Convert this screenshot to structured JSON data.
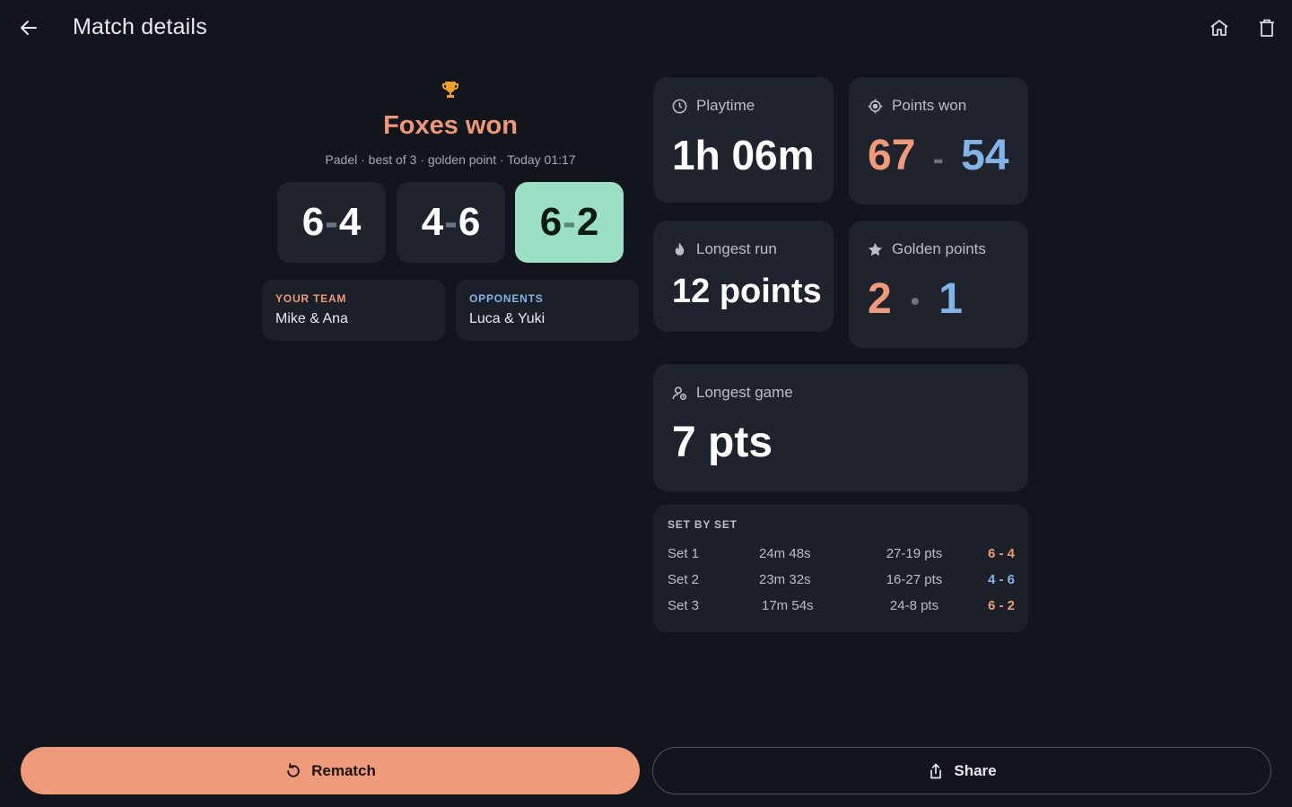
{
  "header": {
    "title": "Match details",
    "back_icon": "arrow-left-icon",
    "home_icon": "home-icon",
    "delete_icon": "trash-icon"
  },
  "summary": {
    "icon": "trophy-icon",
    "winner_text": "Foxes won",
    "meta": "Padel · best of 3 · golden point · Today 01:17"
  },
  "sets": [
    {
      "a": "6",
      "b": "4",
      "winner": false
    },
    {
      "a": "4",
      "b": "6",
      "winner": false
    },
    {
      "a": "6",
      "b": "2",
      "winner": true
    }
  ],
  "teams": {
    "yours": {
      "label": "YOUR TEAM",
      "names": "Mike & Ana"
    },
    "opponents": {
      "label": "OPPONENTS",
      "names": "Luca & Yuki"
    }
  },
  "stats": {
    "playtime": {
      "label": "Playtime",
      "value": "1h 06m",
      "icon": "clock-icon"
    },
    "points_won": {
      "label": "Points won",
      "a": "67",
      "sep": "-",
      "b": "54",
      "icon": "target-icon"
    },
    "longest_run": {
      "label": "Longest run",
      "value": "12 points",
      "icon": "flame-icon"
    },
    "golden_points": {
      "label": "Golden points",
      "a": "2",
      "sep": "•",
      "b": "1",
      "icon": "star-icon"
    },
    "longest_game": {
      "label": "Longest game",
      "value": "7 pts",
      "icon": "person-timer-icon"
    }
  },
  "set_by_set": {
    "title": "SET BY SET",
    "rows": [
      {
        "set": "Set 1",
        "duration": "24m 48s",
        "points": "27-19 pts",
        "score": "6 - 4",
        "winner": "yours"
      },
      {
        "set": "Set 2",
        "duration": "23m 32s",
        "points": "16-27 pts",
        "score": "4 - 6",
        "winner": "opponents"
      },
      {
        "set": "Set 3",
        "duration": "17m 54s",
        "points": "24-8 pts",
        "score": "6 - 2",
        "winner": "yours"
      }
    ]
  },
  "actions": {
    "rematch": {
      "label": "Rematch",
      "icon": "refresh-icon"
    },
    "share": {
      "label": "Share",
      "icon": "share-icon"
    }
  },
  "colors": {
    "accent": "#ef9a7a",
    "team_a": "#ef9a78",
    "team_b": "#82b4e8",
    "winner_tile": "#9ce0c4",
    "background": "#12151b",
    "card": "#1e232d"
  }
}
